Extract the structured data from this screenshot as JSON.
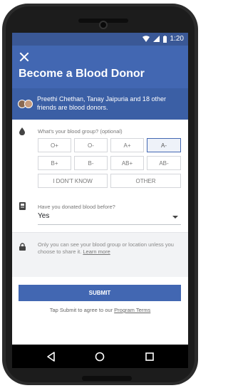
{
  "status_bar": {
    "time": "1:20"
  },
  "header": {
    "title": "Become a Blood Donor",
    "friends_text": "Preethi Chethan, Tanay Jaipuria and 18 other friends are blood donors."
  },
  "blood_group": {
    "question": "What's your blood group? (optional)",
    "options": [
      "O+",
      "O-",
      "A+",
      "A-",
      "B+",
      "B-",
      "AB+",
      "AB-",
      "I DON'T KNOW",
      "OTHER"
    ],
    "selected": "A-"
  },
  "donated": {
    "question": "Have you donated blood before?",
    "value": "Yes"
  },
  "privacy": {
    "text": "Only you can see your blood group or location unless you choose to share it.",
    "learn_more": "Learn more"
  },
  "submit": {
    "label": "SUBMIT",
    "terms_prefix": "Tap Submit to agree to our",
    "terms_link": "Program Terms"
  },
  "icons": {
    "close": "close-icon",
    "blood": "blood-drop-icon",
    "donated": "donor-card-icon",
    "privacy": "lock-icon"
  },
  "colors": {
    "brand": "#4267b2",
    "status_bar": "#3a5896",
    "friends_bar": "#3b5fa5",
    "privacy_bg": "#f2f3f5"
  }
}
